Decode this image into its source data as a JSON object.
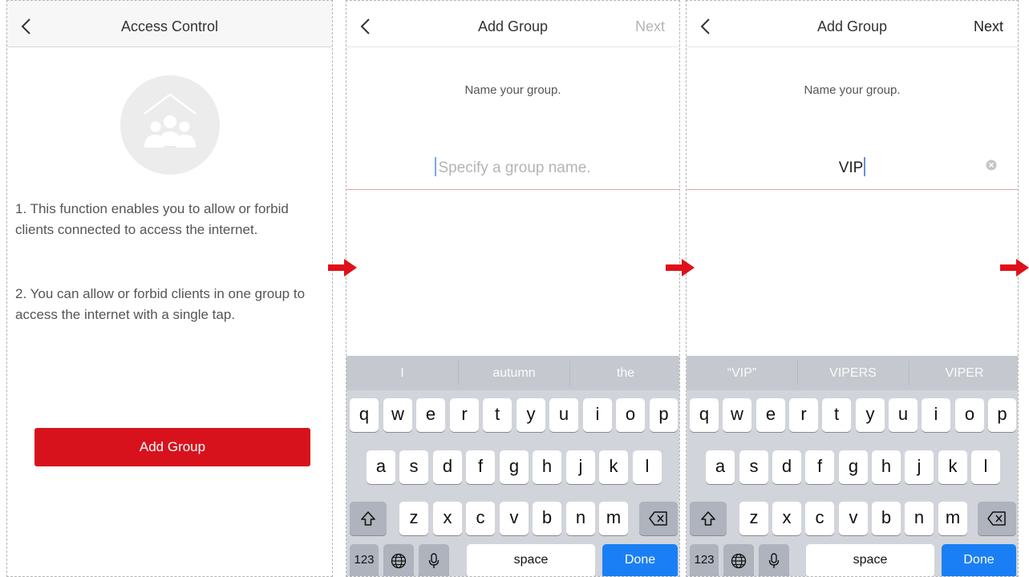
{
  "screen1": {
    "title": "Access Control",
    "desc1": "1. This function enables you to allow or forbid clients connected to access the internet.",
    "desc2": "2. You can allow or forbid clients in one group to access the internet with a single tap.",
    "add_group_label": "Add Group"
  },
  "screen2": {
    "title": "Add Group",
    "next_label": "Next",
    "prompt": "Name your group.",
    "placeholder": "Specify a group name.",
    "suggestions": [
      "I",
      "autumn",
      "the"
    ]
  },
  "screen3": {
    "title": "Add Group",
    "next_label": "Next",
    "prompt": "Name your group.",
    "value": "VIP",
    "suggestions": [
      "“VIP”",
      "VIPERS",
      "VIPER"
    ]
  },
  "keyboard": {
    "row1": [
      "q",
      "w",
      "e",
      "r",
      "t",
      "y",
      "u",
      "i",
      "o",
      "p"
    ],
    "row2": [
      "a",
      "s",
      "d",
      "f",
      "g",
      "h",
      "j",
      "k",
      "l"
    ],
    "row3": [
      "z",
      "x",
      "c",
      "v",
      "b",
      "n",
      "m"
    ],
    "num_label": "123",
    "space_label": "space",
    "done_label": "Done"
  },
  "colors": {
    "accent_red": "#d8121d",
    "done_blue": "#1a7ff5",
    "keyboard_bg": "#d1d4da",
    "arrow_red": "#e0101a"
  },
  "icons": [
    "chevron-left-icon",
    "group-icon",
    "clear-icon",
    "shift-icon",
    "backspace-icon",
    "globe-icon",
    "microphone-icon",
    "arrow-right-icon"
  ]
}
